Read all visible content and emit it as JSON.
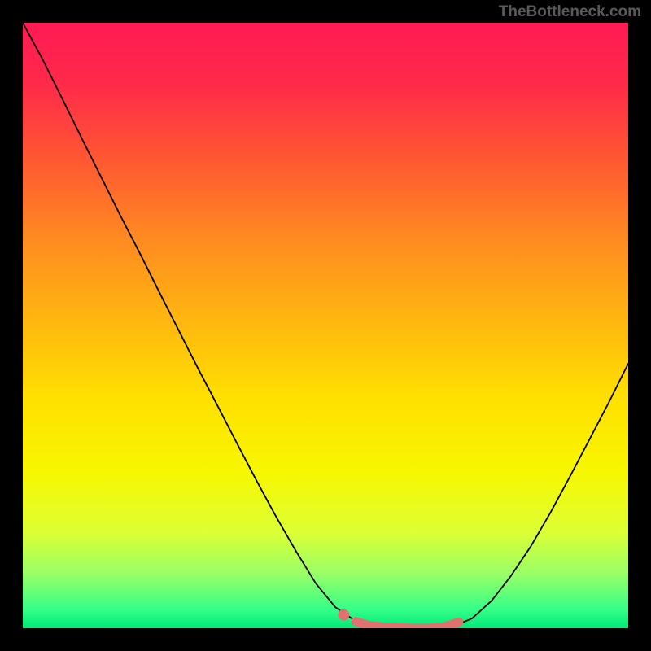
{
  "watermark": "TheBottleneck.com",
  "chart_data": {
    "type": "line",
    "title": "",
    "xlabel": "",
    "ylabel": "",
    "xlim": [
      0,
      100
    ],
    "ylim": [
      0,
      100
    ],
    "background_gradient": {
      "orientation": "vertical",
      "stops": [
        {
          "offset": 0.0,
          "color": "#ff1a55"
        },
        {
          "offset": 0.1,
          "color": "#ff2a4a"
        },
        {
          "offset": 0.22,
          "color": "#ff5533"
        },
        {
          "offset": 0.35,
          "color": "#ff8822"
        },
        {
          "offset": 0.48,
          "color": "#ffb311"
        },
        {
          "offset": 0.62,
          "color": "#ffe000"
        },
        {
          "offset": 0.74,
          "color": "#f7f700"
        },
        {
          "offset": 0.84,
          "color": "#ddff33"
        },
        {
          "offset": 0.91,
          "color": "#99ff66"
        },
        {
          "offset": 0.97,
          "color": "#33ff88"
        },
        {
          "offset": 1.0,
          "color": "#00e878"
        }
      ]
    },
    "series": [
      {
        "name": "curve",
        "stroke": "#000000",
        "stroke_width": 1.8,
        "x": [
          0.0,
          3.2,
          6.5,
          9.7,
          12.9,
          16.1,
          19.4,
          22.6,
          25.8,
          29.0,
          32.3,
          35.5,
          38.7,
          41.9,
          45.2,
          48.4,
          51.6,
          54.8,
          58.1,
          61.3,
          64.5,
          67.7,
          71.0,
          74.2,
          77.4,
          80.6,
          83.9,
          87.1,
          90.3,
          93.5,
          96.8,
          100.0
        ],
        "y": [
          100.0,
          94.1,
          87.5,
          81.0,
          74.6,
          68.2,
          61.8,
          55.4,
          49.1,
          42.8,
          36.5,
          30.3,
          24.2,
          18.3,
          12.6,
          7.4,
          3.5,
          1.3,
          0.4,
          0.1,
          0.0,
          0.0,
          0.3,
          1.6,
          4.5,
          8.6,
          13.5,
          19.0,
          24.9,
          31.0,
          37.3,
          43.7
        ]
      },
      {
        "name": "highlight",
        "type": "marker_band",
        "stroke": "#e17070",
        "stroke_width": 11,
        "x": [
          55.0,
          57.0,
          59.5,
          62.0,
          64.5,
          67.0,
          69.5,
          72.0
        ],
        "y": [
          1.1,
          0.5,
          0.2,
          0.1,
          0.0,
          0.0,
          0.2,
          1.0
        ]
      },
      {
        "name": "highlight_left_dot",
        "type": "marker",
        "fill": "#e17070",
        "x": [
          53.0
        ],
        "y": [
          2.2
        ],
        "r": 7
      }
    ]
  }
}
